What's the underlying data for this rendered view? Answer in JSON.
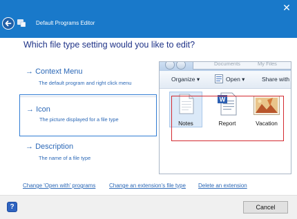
{
  "window": {
    "title": "Default Programs Editor",
    "close_glyph": "✕"
  },
  "heading": "Which file type setting would you like to edit?",
  "options": [
    {
      "arrow": "→",
      "title": "Context Menu",
      "description": "The default program and right click menu"
    },
    {
      "arrow": "→",
      "title": "Icon",
      "description": "The picture displayed for a file type"
    },
    {
      "arrow": "→",
      "title": "Description",
      "description": "The name of a file type"
    }
  ],
  "preview": {
    "address_parts": [
      "Documents",
      "My Files"
    ],
    "toolbar": {
      "organize": "Organize ▾",
      "open": "Open ▾",
      "share": "Share with"
    },
    "files": [
      {
        "label": "Notes",
        "icon": "text-file-icon"
      },
      {
        "label": "Report",
        "icon": "word-document-icon"
      },
      {
        "label": "Vacation",
        "icon": "image-file-icon"
      }
    ]
  },
  "links": {
    "change_open_with": "Change 'Open with' programs",
    "change_extension": "Change an extension's file type",
    "delete_extension": "Delete an extension"
  },
  "footer": {
    "help_glyph": "?",
    "cancel_label": "Cancel"
  },
  "colors": {
    "title_bar": "#1979ca",
    "link": "#2a67b6",
    "selection_border": "#2f7bd3",
    "preview_highlight": "#d3282e"
  }
}
